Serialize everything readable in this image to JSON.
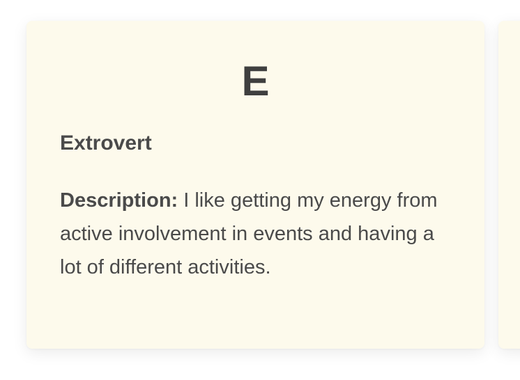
{
  "card": {
    "letter": "E",
    "type_name": "Extrovert",
    "description_label": "Description:",
    "description_text": "I like getting my energy from active involvement in events and having a lot of different activities."
  },
  "colors": {
    "card_background": "#fdfaec",
    "text": "#4a4a4a"
  }
}
